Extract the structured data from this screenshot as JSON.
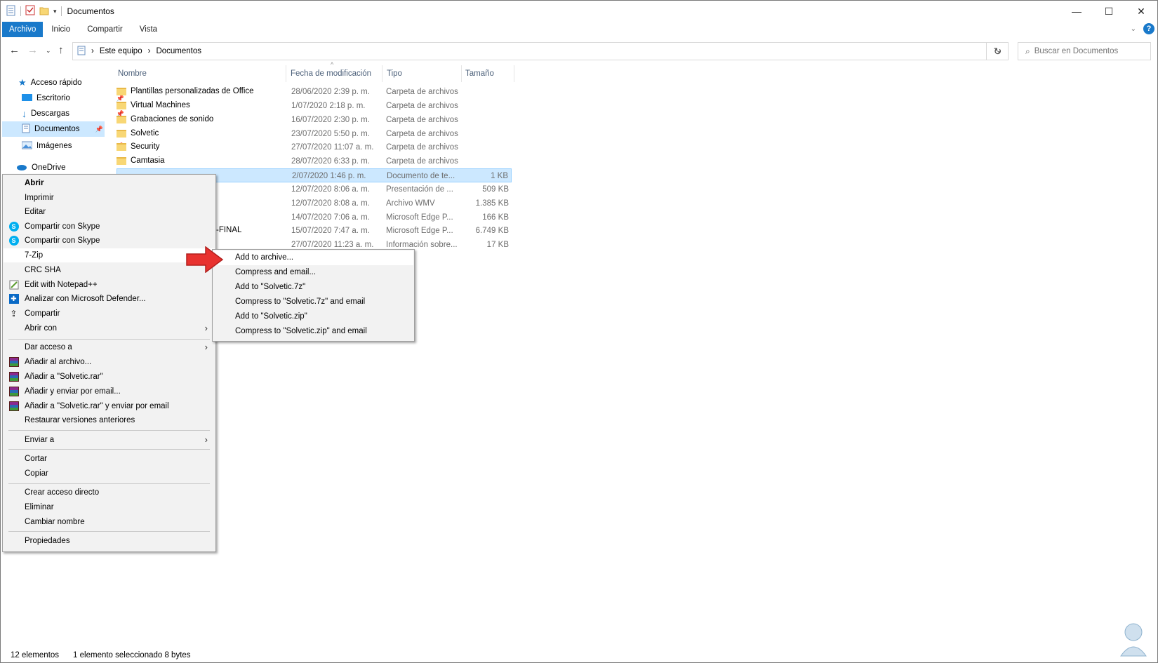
{
  "window": {
    "title": "Documentos",
    "controls": {
      "minimize": "—",
      "maximize": "☐",
      "close": "✕"
    }
  },
  "ribbon": {
    "tabs": [
      "Archivo",
      "Inicio",
      "Compartir",
      "Vista"
    ],
    "help": "?"
  },
  "address": {
    "crumbs": [
      "Este equipo",
      "Documentos"
    ],
    "search_placeholder": "Buscar en Documentos"
  },
  "nav": {
    "items": [
      {
        "label": "Acceso rápido",
        "icon": "star-icon"
      },
      {
        "label": "Escritorio",
        "icon": "desktop-icon",
        "pinned": true
      },
      {
        "label": "Descargas",
        "icon": "download-icon",
        "pinned": true
      },
      {
        "label": "Documentos",
        "icon": "document-icon",
        "pinned": true,
        "selected": true
      },
      {
        "label": "Imágenes",
        "icon": "image-icon",
        "pinned": true
      },
      {
        "label": "OneDrive",
        "icon": "cloud-icon"
      }
    ]
  },
  "columns": [
    "Nombre",
    "Fecha de modificación",
    "Tipo",
    "Tamaño"
  ],
  "files": [
    {
      "name": "Plantillas personalizadas de Office",
      "date": "28/06/2020 2:39 p. m.",
      "type": "Carpeta de archivos",
      "size": ""
    },
    {
      "name": "Virtual Machines",
      "date": "1/07/2020 2:18 p. m.",
      "type": "Carpeta de archivos",
      "size": ""
    },
    {
      "name": "Grabaciones de sonido",
      "date": "16/07/2020 2:30 p. m.",
      "type": "Carpeta de archivos",
      "size": ""
    },
    {
      "name": "Solvetic",
      "date": "23/07/2020 5:50 p. m.",
      "type": "Carpeta de archivos",
      "size": ""
    },
    {
      "name": "Security",
      "date": "27/07/2020 11:07 a. m.",
      "type": "Carpeta de archivos",
      "size": ""
    },
    {
      "name": "Camtasia",
      "date": "28/07/2020 6:33 p. m.",
      "type": "Carpeta de archivos",
      "size": ""
    },
    {
      "name": "",
      "date": "2/07/2020 1:46 p. m.",
      "type": "Documento de te...",
      "size": "1 KB",
      "selected": true
    },
    {
      "name": "",
      "date": "12/07/2020 8:06 a. m.",
      "type": "Presentación de ...",
      "size": "509 KB"
    },
    {
      "name": "",
      "date": "12/07/2020 8:08 a. m.",
      "type": "Archivo WMV",
      "size": "1.385 KB"
    },
    {
      "name": "",
      "date": "14/07/2020 7:06 a. m.",
      "type": "Microsoft Edge P...",
      "size": "166 KB"
    },
    {
      "name": "-FINAL",
      "date": "15/07/2020 7:47 a. m.",
      "type": "Microsoft Edge P...",
      "size": "6.749 KB"
    },
    {
      "name": "",
      "date": "27/07/2020 11:23 a. m.",
      "type": "Información sobre...",
      "size": "17 KB"
    }
  ],
  "context_menu": {
    "items": [
      "Abrir",
      "Imprimir",
      "Editar",
      "Compartir con Skype",
      "Compartir con Skype",
      "7-Zip",
      "CRC SHA",
      "Edit with Notepad++",
      "Analizar con Microsoft Defender...",
      "Compartir",
      "Abrir con",
      "Dar acceso a",
      "Añadir al archivo...",
      "Añadir a \"Solvetic.rar\"",
      "Añadir y enviar por email...",
      "Añadir a \"Solvetic.rar\" y enviar por email",
      "Restaurar versiones anteriores",
      "Enviar a",
      "Cortar",
      "Copiar",
      "Crear acceso directo",
      "Eliminar",
      "Cambiar nombre",
      "Propiedades"
    ]
  },
  "submenu_7zip": {
    "items": [
      "Add to archive...",
      "Compress and email...",
      "Add to \"Solvetic.7z\"",
      "Compress to \"Solvetic.7z\" and email",
      "Add to \"Solvetic.zip\"",
      "Compress to \"Solvetic.zip\" and email"
    ]
  },
  "status": {
    "count": "12 elementos",
    "selection": "1 elemento seleccionado  8 bytes"
  },
  "colors": {
    "accent": "#1979ca",
    "selection": "#cce8ff",
    "menu_bg": "#f2f2f2",
    "red_arrow": "#e8322f"
  }
}
